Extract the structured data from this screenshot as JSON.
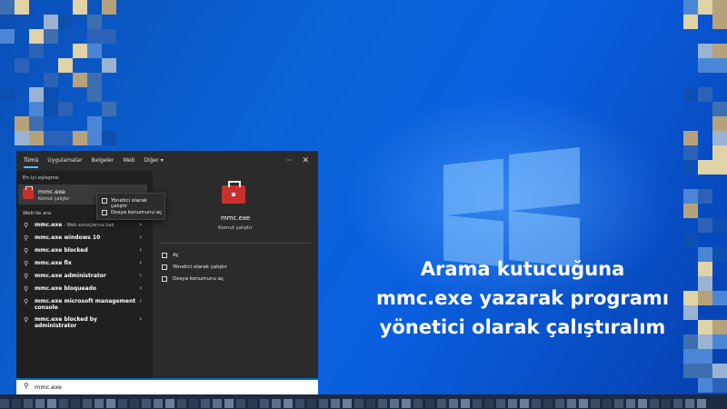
{
  "caption": {
    "line1": "Arama kutucuğuna",
    "line2": "mmc.exe yazarak programı",
    "line3": "yönetici olarak çalıştıralım"
  },
  "search_panel": {
    "tabs": [
      "Tümü",
      "Uygulamalar",
      "Belgeler",
      "Web",
      "Diğer ▾"
    ],
    "more_label": "···",
    "close_label": "✕",
    "best_match_heading": "En iyi eşleşme",
    "best_match": {
      "name": "mmc.exe",
      "type": "Komut çalıştır"
    },
    "web_heading": "Web'de ara",
    "web_results": [
      {
        "bold": "mmc.exe",
        "rest": " - Web sonuçlarına bak"
      },
      {
        "bold": "mmc.exe windows 10",
        "rest": ""
      },
      {
        "bold": "mmc.exe blocked",
        "rest": ""
      },
      {
        "bold": "mmc.exe fix",
        "rest": ""
      },
      {
        "bold": "mmc.exe administrator",
        "rest": ""
      },
      {
        "bold": "mmc.exe bloqueado",
        "rest": ""
      },
      {
        "bold": "mmc.exe microsoft management console",
        "rest": ""
      },
      {
        "bold": "mmc.exe blocked by administrator",
        "rest": ""
      }
    ],
    "context_menu": [
      "Yönetici olarak çalıştır",
      "Dosya konumunu aç"
    ],
    "detail": {
      "name": "mmc.exe",
      "type": "Komut çalıştır",
      "actions": [
        "Aç",
        "Yönetici olarak çalıştır",
        "Dosya konumunu aç"
      ]
    }
  },
  "search_box": {
    "value": "mmc.exe"
  },
  "colors": {
    "accent": "#4cc2ff",
    "app_icon": "#c9302c",
    "desktop": "#0b63d6"
  }
}
